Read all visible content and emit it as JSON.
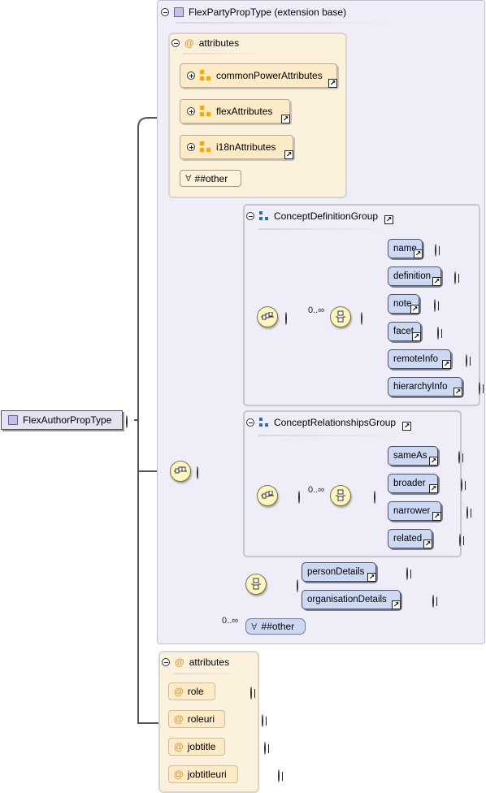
{
  "root": {
    "label": "FlexAuthorPropType"
  },
  "extension": {
    "title": "FlexPartyPropType (extension base)"
  },
  "ext_attributes": {
    "title": "attributes",
    "groups": [
      "commonPowerAttributes",
      "flexAttributes",
      "i18nAttributes"
    ],
    "any_attribute": "##other"
  },
  "concept_definition_group": {
    "title": "ConceptDefinitionGroup",
    "occurrence": "0..∞",
    "elements": [
      "name",
      "definition",
      "note",
      "facet",
      "remoteInfo",
      "hierarchyInfo"
    ]
  },
  "concept_relationships_group": {
    "title": "ConceptRelationshipsGroup",
    "occurrence": "0..∞",
    "elements": [
      "sameAs",
      "broader",
      "narrower",
      "related"
    ]
  },
  "choice_details": {
    "elements": [
      "personDetails",
      "organisationDetails"
    ]
  },
  "any_element": {
    "occurrence": "0..∞",
    "label": "##other"
  },
  "own_attributes": {
    "title": "attributes",
    "items": [
      "role",
      "roleuri",
      "jobtitle",
      "jobtitleuri"
    ]
  },
  "icons": {
    "complex-type": "square-icon",
    "attributes": "at-icon",
    "attribute-group": "attribute-group-icon",
    "model-group": "group-icon",
    "sequence": "sequence-compositor-icon",
    "choice": "choice-compositor-icon",
    "reference": "reference-arrow-icon",
    "any": "wildcard-icon"
  },
  "colors": {
    "element_fill": "#cdd9f2",
    "attribute_fill": "#fdeac6",
    "panel_fill": "#efeef8",
    "compositor_fill": "#fff6c2"
  }
}
